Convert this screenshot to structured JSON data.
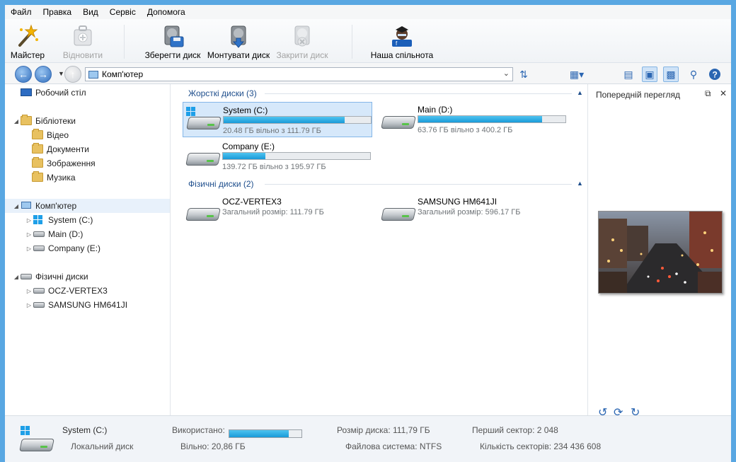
{
  "menu": [
    "Файл",
    "Правка",
    "Вид",
    "Сервіс",
    "Допомога"
  ],
  "toolbar": {
    "wizard": "Майстер",
    "restore": "Відновити",
    "save_disk": "Зберегти диск",
    "mount_disk": "Монтувати диск",
    "close_disk": "Закрити диск",
    "community": "Наша спільнота"
  },
  "address": {
    "text": "Комп'ютер"
  },
  "tree": {
    "desktop": "Робочий стіл",
    "libraries": "Бібліотеки",
    "video": "Відео",
    "documents": "Документи",
    "images": "Зображення",
    "music": "Музика",
    "computer": "Комп'ютер",
    "system": "System (C:)",
    "main": "Main (D:)",
    "company": "Company (E:)",
    "physical": "Фізичні диски",
    "ocz": "OCZ-VERTEX3",
    "samsung": "SAMSUNG HM641JI"
  },
  "content": {
    "hard_disks_header": "Жорсткі диски (3)",
    "physical_disks_header": "Фізичні диски (2)",
    "drives": [
      {
        "name": "System (C:)",
        "free": "20.48 ГБ вільно з 111.79 ГБ",
        "used_fraction": 0.82
      },
      {
        "name": "Main (D:)",
        "free": "63.76 ГБ вільно з 400.2 ГБ",
        "used_fraction": 0.84
      },
      {
        "name": "Company (E:)",
        "free": "139.72 ГБ вільно з 195.97 ГБ",
        "used_fraction": 0.29
      }
    ],
    "physical": [
      {
        "name": "OCZ-VERTEX3",
        "size": "Загальний розмір: 111.79 ГБ"
      },
      {
        "name": "SAMSUNG HM641JI",
        "size": "Загальний розмір: 596.17 ГБ"
      }
    ]
  },
  "preview": {
    "title": "Попередній перегляд"
  },
  "status": {
    "name": "System (C:)",
    "type": "Локальний диск",
    "used_label": "Використано:",
    "used_fraction": 0.82,
    "free": "Вільно: 20,86 ГБ",
    "size": "Розмір диска: 111,79 ГБ",
    "fs": "Файлова система: NTFS",
    "first_sector": "Перший сектор: 2 048",
    "sector_count": "Кількість секторів: 234 436 608"
  },
  "colors": {
    "accent": "#1a9ad8",
    "frame": "#59a7e2",
    "header_text": "#1e4e8c"
  }
}
